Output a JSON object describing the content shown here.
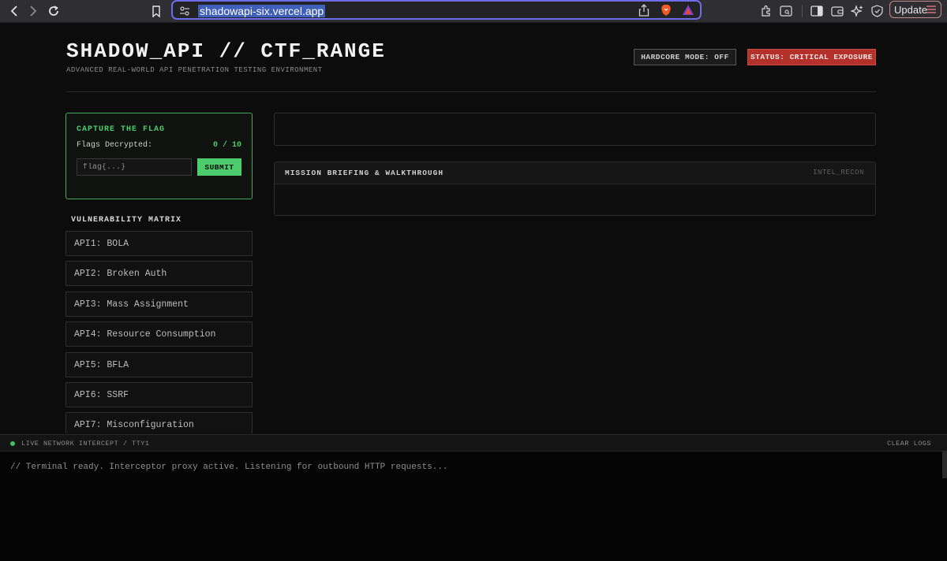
{
  "browser": {
    "url": "shadowapi-six.vercel.app",
    "update_label": "Update"
  },
  "header": {
    "title": "SHADOW_API // CTF_RANGE",
    "subtitle": "ADVANCED REAL-WORLD API PENETRATION TESTING ENVIRONMENT",
    "hardcore_badge": "HARDCORE MODE: OFF",
    "status_badge": "STATUS: CRITICAL EXPOSURE"
  },
  "capture": {
    "title": "CAPTURE THE FLAG",
    "flags_label": "Flags Decrypted:",
    "flags_count": "0 / 10",
    "input_placeholder": "flag{...}",
    "submit_label": "SUBMIT"
  },
  "matrix": {
    "title": "VULNERABILITY MATRIX",
    "items": [
      "API1: BOLA",
      "API2: Broken Auth",
      "API3: Mass Assignment",
      "API4: Resource Consumption",
      "API5: BFLA",
      "API6: SSRF",
      "API7: Misconfiguration"
    ]
  },
  "mission": {
    "title": "MISSION BRIEFING & WALKTHROUGH",
    "tag": "INTEL_RECON"
  },
  "terminal": {
    "label": "LIVE NETWORK INTERCEPT / TTY1",
    "clear_label": "CLEAR LOGS",
    "line": "// Terminal ready. Interceptor proxy active. Listening for outbound HTTP requests..."
  },
  "colors": {
    "accent_green": "#4ccc6a",
    "status_red": "#b3302b",
    "background": "#0c0c0c"
  }
}
